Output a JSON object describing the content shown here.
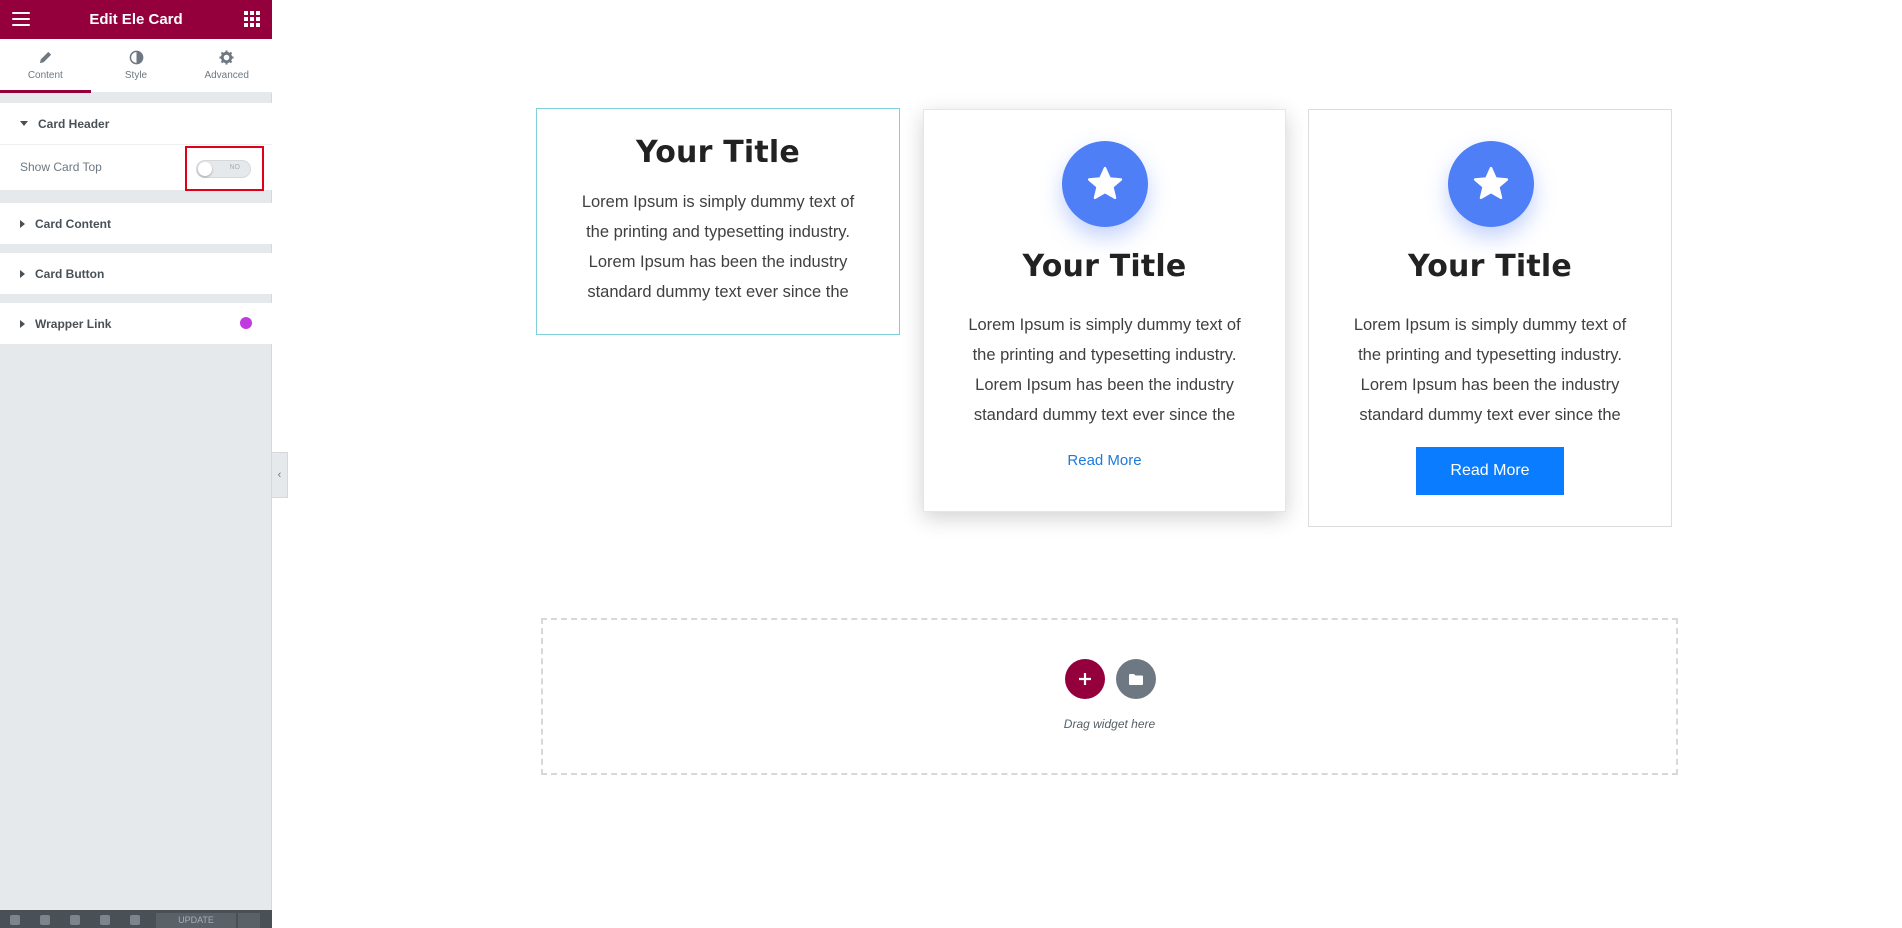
{
  "panel": {
    "title": "Edit Ele Card",
    "tabs": [
      {
        "label": "Content",
        "icon": "pencil-icon"
      },
      {
        "label": "Style",
        "icon": "contrast-icon"
      },
      {
        "label": "Advanced",
        "icon": "gear-icon"
      }
    ],
    "sections": {
      "card_header": "Card Header",
      "show_card_top_label": "Show Card Top",
      "toggle_value": "NO",
      "card_content": "Card Content",
      "card_button": "Card Button",
      "wrapper_link": "Wrapper Link"
    },
    "footer": {
      "update_label": "UPDATE"
    }
  },
  "cards": [
    {
      "title": "Your Title",
      "lines": [
        "Lorem Ipsum is simply dummy text of",
        "the printing and typesetting industry.",
        "Lorem Ipsum has been the industry",
        "standard dummy text ever since the"
      ]
    },
    {
      "title": "Your Title",
      "lines": [
        "Lorem Ipsum is simply dummy text of",
        "the printing and typesetting industry.",
        "Lorem Ipsum has been the industry",
        "standard dummy text ever since the"
      ],
      "link": "Read More"
    },
    {
      "title": "Your Title",
      "lines": [
        "Lorem Ipsum is simply dummy text of",
        "the printing and typesetting industry.",
        "Lorem Ipsum has been the industry",
        "standard dummy text ever since the"
      ],
      "button": "Read More"
    }
  ],
  "dropzone": {
    "text": "Drag widget here"
  },
  "colors": {
    "brand": "#93003c",
    "accent_blue": "#0a7cff",
    "icon_blue": "#4f7ff7",
    "highlight": "#e0001a"
  }
}
